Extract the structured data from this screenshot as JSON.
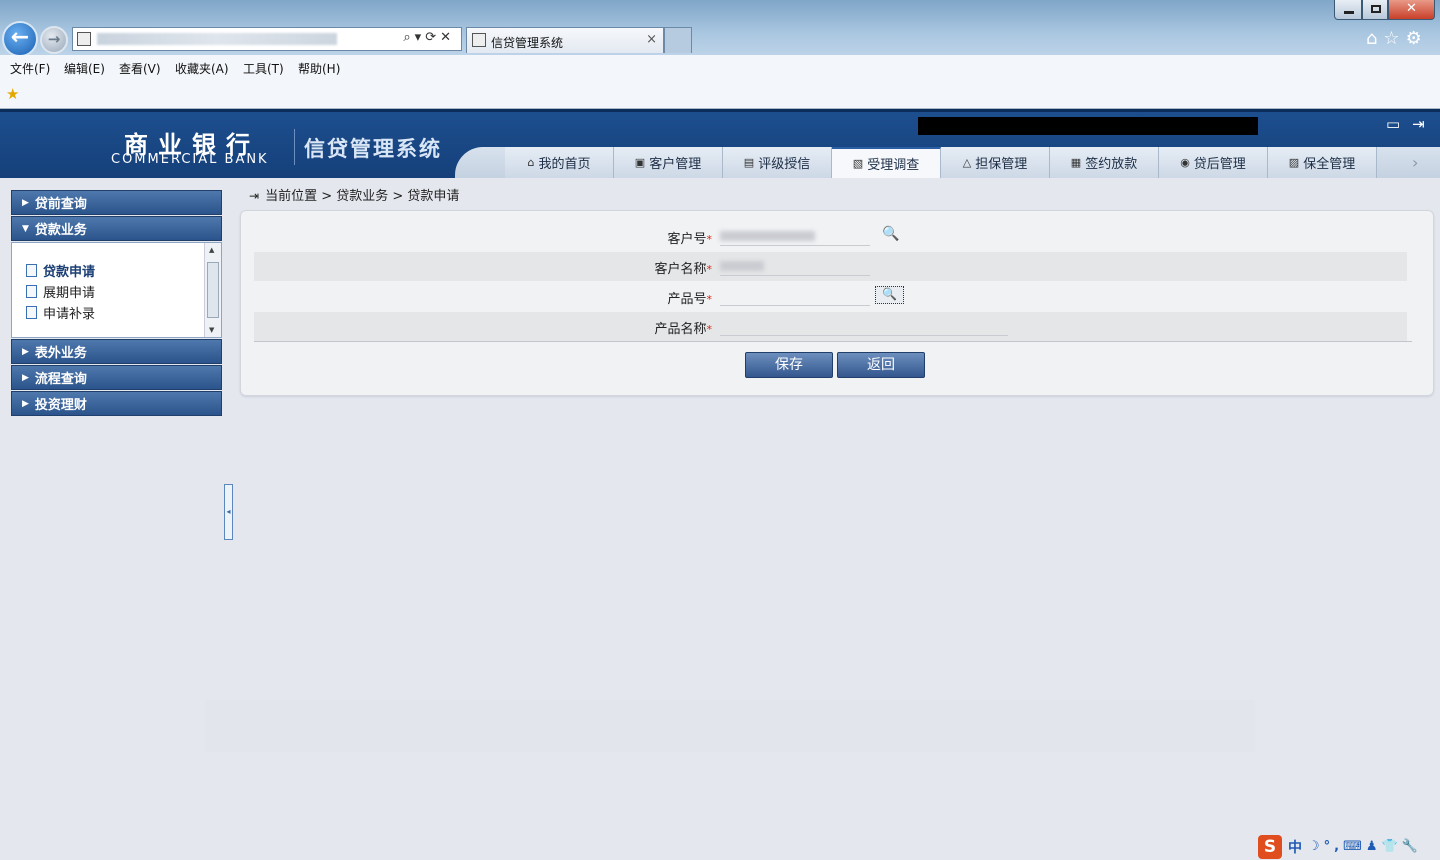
{
  "browser": {
    "tab_title": "信贷管理系统",
    "tab_close": "×",
    "menu": [
      "文件(F)",
      "编辑(E)",
      "查看(V)",
      "收藏夹(A)",
      "工具(T)",
      "帮助(H)"
    ],
    "addr_icons": "⌕▾⟳✕",
    "right_icons": "⌂☆⚙",
    "close_glyph": "✕"
  },
  "header": {
    "logo_cn": "商业银行",
    "logo_en": "COMMERCIAL BANK",
    "system_title": "信贷管理系统",
    "icons": "▭⇥"
  },
  "nav": {
    "tabs": [
      {
        "label": "我的首页",
        "icon": "home-icon",
        "glyph": "⌂"
      },
      {
        "label": "客户管理",
        "icon": "customer-icon",
        "glyph": "▣"
      },
      {
        "label": "评级授信",
        "icon": "rating-icon",
        "glyph": "▤"
      },
      {
        "label": "受理调查",
        "icon": "survey-icon",
        "glyph": "▧"
      },
      {
        "label": "担保管理",
        "icon": "guarantee-icon",
        "glyph": "△"
      },
      {
        "label": "签约放款",
        "icon": "contract-icon",
        "glyph": "▦"
      },
      {
        "label": "贷后管理",
        "icon": "post-loan-icon",
        "glyph": "◉"
      },
      {
        "label": "保全管理",
        "icon": "preservation-icon",
        "glyph": "▨"
      }
    ],
    "active_index": 3,
    "next_glyph": "›"
  },
  "sidebar": {
    "groups": [
      {
        "label": "贷前查询",
        "expanded": false
      },
      {
        "label": "贷款业务",
        "expanded": true
      },
      {
        "label": "表外业务",
        "expanded": false
      },
      {
        "label": "流程查询",
        "expanded": false
      },
      {
        "label": "投资理财",
        "expanded": false
      }
    ],
    "items": [
      {
        "label": "贷款申请",
        "active": true
      },
      {
        "label": "展期申请",
        "active": false
      },
      {
        "label": "申请补录",
        "active": false
      }
    ],
    "collapse_glyph": "◂"
  },
  "breadcrumb": {
    "icon_glyph": "⇥",
    "text": "当前位置 > 贷款业务 > 贷款申请"
  },
  "form": {
    "fields": [
      {
        "label": "客户号",
        "required_mark": "*",
        "value": "",
        "lookup": "plain"
      },
      {
        "label": "客户名称",
        "required_mark": "*",
        "value": "",
        "lookup": "none"
      },
      {
        "label": "产品号",
        "required_mark": "*",
        "value": "",
        "lookup": "boxed"
      },
      {
        "label": "产品名称",
        "required_mark": "*",
        "value": "",
        "lookup": "none"
      }
    ],
    "lookup_glyph": "🔍",
    "buttons": {
      "save": "保存",
      "back": "返回"
    }
  },
  "ime": {
    "logo": "S",
    "mode": "中",
    "icons": "☽°,⌨♟👕🔧"
  },
  "colors": {
    "header_blue": "#1d4f8f",
    "button_blue": "#33578e",
    "required_red": "#dd2211"
  }
}
